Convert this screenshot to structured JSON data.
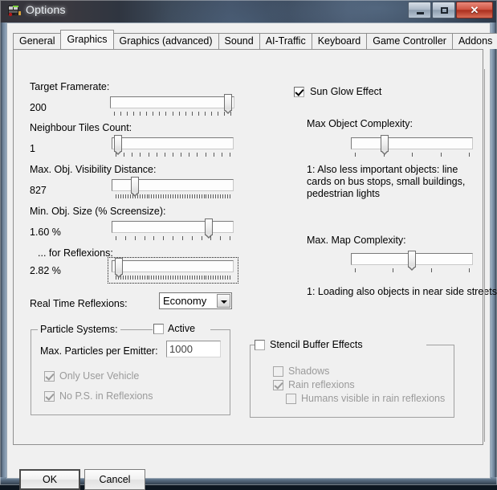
{
  "window": {
    "title": "Options",
    "icon": "bus-icon",
    "buttons": {
      "minimize": "minimize-icon",
      "maximize": "maximize-icon",
      "close": "✕"
    }
  },
  "tabs": [
    {
      "label": "General",
      "active": false
    },
    {
      "label": "Graphics",
      "active": true
    },
    {
      "label": "Graphics (advanced)",
      "active": false
    },
    {
      "label": "Sound",
      "active": false
    },
    {
      "label": "AI-Traffic",
      "active": false
    },
    {
      "label": "Keyboard",
      "active": false
    },
    {
      "label": "Game Controller",
      "active": false
    },
    {
      "label": "Addons",
      "active": false
    }
  ],
  "left": {
    "target_framerate": {
      "label": "Target Framerate:",
      "value": "200",
      "thumb_pct": 98,
      "ticks": 18
    },
    "neighbour_tiles": {
      "label": "Neighbour Tiles Count:",
      "value": "1",
      "thumb_pct": 2,
      "ticks": 14
    },
    "visibility_distance": {
      "label": "Max. Obj. Visibility Distance:",
      "value": "827",
      "thumb_pct": 17,
      "ticks": 48
    },
    "min_obj_size": {
      "label": "Min. Obj. Size (% Screensize):",
      "value": "1.60 %",
      "thumb_pct": 82,
      "ticks": 12
    },
    "min_obj_size_reflexions": {
      "label": "... for Reflexions:",
      "value": "2.82 %",
      "thumb_pct": 3,
      "ticks": 48,
      "focused": true
    },
    "real_time_reflexions": {
      "label": "Real Time Reflexions:",
      "value": "Economy"
    }
  },
  "right": {
    "sun_glow": {
      "label": "Sun Glow Effect",
      "checked": true,
      "enabled": true
    },
    "max_object_complexity": {
      "label": "Max Object Complexity:",
      "thumb_pct": 26,
      "ticks": 4
    },
    "object_complexity_hint": "1: Also less important objects: line cards on bus stops, small buildings, pedestrian lights",
    "max_map_complexity": {
      "label": "Max. Map Complexity:",
      "thumb_pct": 50,
      "ticks": 3
    },
    "map_complexity_hint": "1: Loading also objects in near side streets"
  },
  "particle_systems": {
    "caption": "Particle Systems:",
    "active": {
      "label": "Active",
      "checked": false,
      "enabled": true
    },
    "max_particles": {
      "label": "Max. Particles per Emitter:",
      "value": "1000"
    },
    "only_user_vehicle": {
      "label": "Only User Vehicle",
      "checked": true,
      "enabled": false
    },
    "no_ps_in_reflexions": {
      "label": "No P.S. in Reflexions",
      "checked": true,
      "enabled": false
    }
  },
  "stencil": {
    "effects": {
      "label": "Stencil Buffer Effects",
      "checked": false,
      "enabled": true
    },
    "shadows": {
      "label": "Shadows",
      "checked": false,
      "enabled": false
    },
    "rain_reflexions": {
      "label": "Rain reflexions",
      "checked": true,
      "enabled": false
    },
    "humans_visible": {
      "label": "Humans visible in rain reflexions",
      "checked": false,
      "enabled": false
    }
  },
  "footer": {
    "ok": "OK",
    "cancel": "Cancel"
  },
  "colors": {
    "face": "#f0f0f0",
    "close_button": "#cf5443",
    "disabled_text": "#9a9a9a"
  }
}
